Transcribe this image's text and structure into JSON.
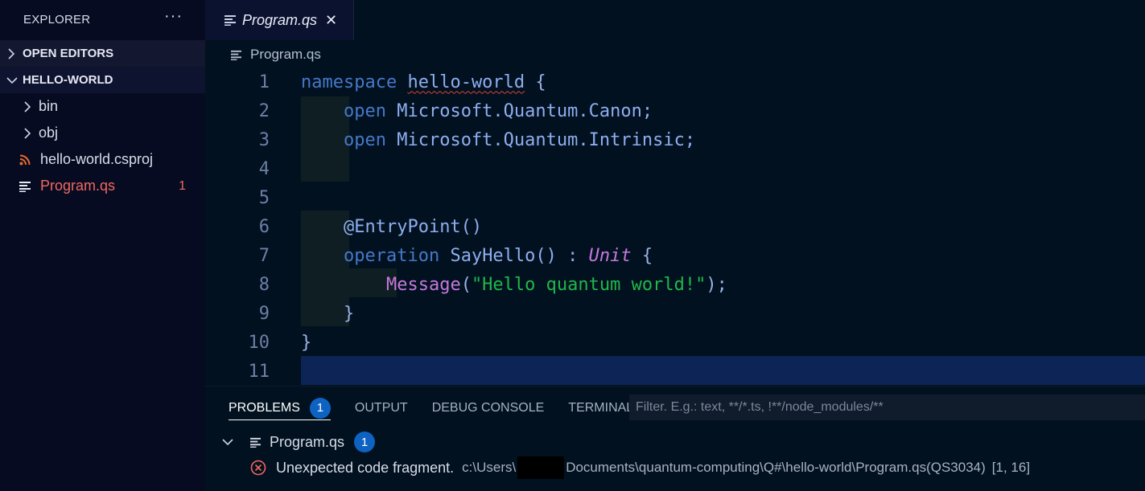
{
  "explorer": {
    "title": "EXPLORER",
    "more": "···",
    "sections": {
      "open_editors": "OPEN EDITORS",
      "project": "HELLO-WORLD"
    },
    "tree": [
      {
        "label": "bin",
        "kind": "folder"
      },
      {
        "label": "obj",
        "kind": "folder"
      },
      {
        "label": "hello-world.csproj",
        "kind": "file",
        "icon": "rss-icon"
      },
      {
        "label": "Program.qs",
        "kind": "file",
        "icon": "lines-icon",
        "error_count": "1"
      }
    ]
  },
  "tab": {
    "label": "Program.qs",
    "close": "✕"
  },
  "breadcrumb": {
    "label": "Program.qs"
  },
  "editor": {
    "line_numbers": [
      "1",
      "2",
      "3",
      "4",
      "5",
      "6",
      "7",
      "8",
      "9",
      "10",
      "11"
    ],
    "lines": {
      "l1": {
        "kw": "namespace",
        "name": "hello-world",
        "brace": " {"
      },
      "l2": {
        "kw": "open",
        "ns": "Microsoft.Quantum.Canon;"
      },
      "l3": {
        "kw": "open",
        "ns": "Microsoft.Quantum.Intrinsic;"
      },
      "l6": {
        "attr": "@EntryPoint()"
      },
      "l7": {
        "kw": "operation",
        "name": "SayHello() : ",
        "type": "Unit",
        "brace": " {"
      },
      "l8": {
        "fn": "Message",
        "open": "(",
        "str": "\"Hello quantum world!\"",
        "close": ");"
      },
      "l9": {
        "brace": "}"
      },
      "l10": {
        "brace": "}"
      }
    }
  },
  "panel": {
    "tabs": {
      "problems": "PROBLEMS",
      "problems_count": "1",
      "output": "OUTPUT",
      "debug_console": "DEBUG CONSOLE",
      "terminal": "TERMINAL"
    },
    "filter_placeholder": "Filter. E.g.: text, **/*.ts, !**/node_modules/**",
    "file": {
      "label": "Program.qs",
      "count": "1"
    },
    "problem": {
      "message": "Unexpected code fragment.",
      "path_prefix": "c:\\Users\\",
      "path_suffix": "Documents\\quantum-computing\\Q#\\hello-world\\Program.qs(QS3034)",
      "location": "[1, 16]"
    }
  },
  "colors": {
    "background": "#01111f",
    "sidebar": "#070b22",
    "keyword": "#4678c8",
    "string": "#1fb84a",
    "error": "#f1685e",
    "badge": "#0e63c2"
  }
}
